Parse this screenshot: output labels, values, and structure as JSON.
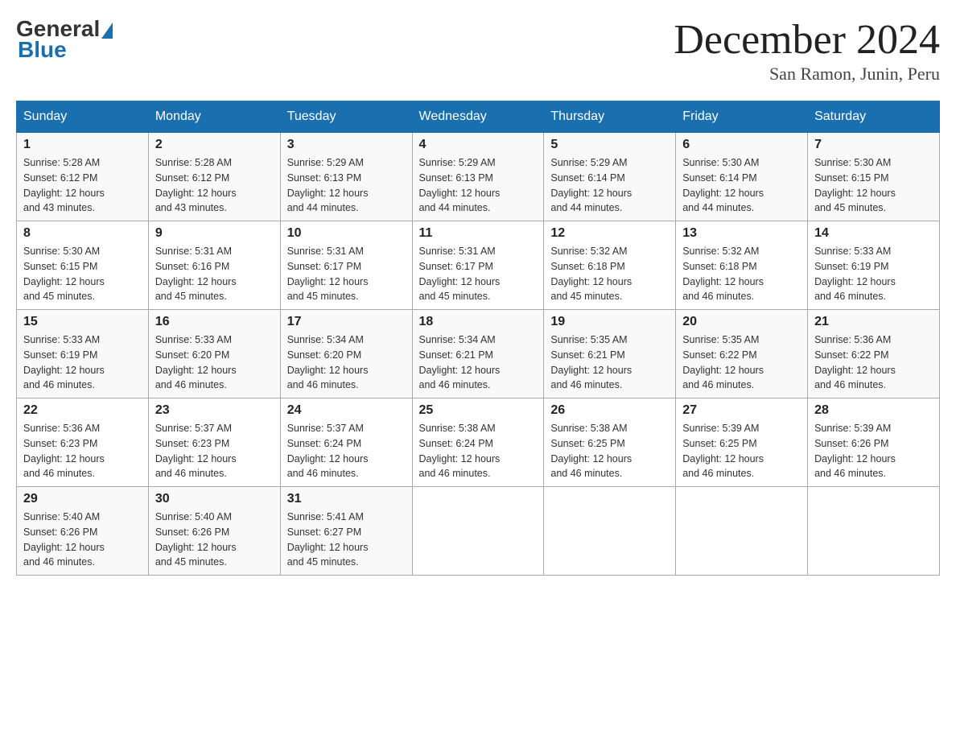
{
  "header": {
    "logo": {
      "general_text": "General",
      "blue_text": "Blue"
    },
    "title": "December 2024",
    "location": "San Ramon, Junin, Peru"
  },
  "days_of_week": [
    "Sunday",
    "Monday",
    "Tuesday",
    "Wednesday",
    "Thursday",
    "Friday",
    "Saturday"
  ],
  "weeks": [
    [
      {
        "day": 1,
        "sunrise": "5:28 AM",
        "sunset": "6:12 PM",
        "daylight": "12 hours and 43 minutes."
      },
      {
        "day": 2,
        "sunrise": "5:28 AM",
        "sunset": "6:12 PM",
        "daylight": "12 hours and 43 minutes."
      },
      {
        "day": 3,
        "sunrise": "5:29 AM",
        "sunset": "6:13 PM",
        "daylight": "12 hours and 44 minutes."
      },
      {
        "day": 4,
        "sunrise": "5:29 AM",
        "sunset": "6:13 PM",
        "daylight": "12 hours and 44 minutes."
      },
      {
        "day": 5,
        "sunrise": "5:29 AM",
        "sunset": "6:14 PM",
        "daylight": "12 hours and 44 minutes."
      },
      {
        "day": 6,
        "sunrise": "5:30 AM",
        "sunset": "6:14 PM",
        "daylight": "12 hours and 44 minutes."
      },
      {
        "day": 7,
        "sunrise": "5:30 AM",
        "sunset": "6:15 PM",
        "daylight": "12 hours and 45 minutes."
      }
    ],
    [
      {
        "day": 8,
        "sunrise": "5:30 AM",
        "sunset": "6:15 PM",
        "daylight": "12 hours and 45 minutes."
      },
      {
        "day": 9,
        "sunrise": "5:31 AM",
        "sunset": "6:16 PM",
        "daylight": "12 hours and 45 minutes."
      },
      {
        "day": 10,
        "sunrise": "5:31 AM",
        "sunset": "6:17 PM",
        "daylight": "12 hours and 45 minutes."
      },
      {
        "day": 11,
        "sunrise": "5:31 AM",
        "sunset": "6:17 PM",
        "daylight": "12 hours and 45 minutes."
      },
      {
        "day": 12,
        "sunrise": "5:32 AM",
        "sunset": "6:18 PM",
        "daylight": "12 hours and 45 minutes."
      },
      {
        "day": 13,
        "sunrise": "5:32 AM",
        "sunset": "6:18 PM",
        "daylight": "12 hours and 46 minutes."
      },
      {
        "day": 14,
        "sunrise": "5:33 AM",
        "sunset": "6:19 PM",
        "daylight": "12 hours and 46 minutes."
      }
    ],
    [
      {
        "day": 15,
        "sunrise": "5:33 AM",
        "sunset": "6:19 PM",
        "daylight": "12 hours and 46 minutes."
      },
      {
        "day": 16,
        "sunrise": "5:33 AM",
        "sunset": "6:20 PM",
        "daylight": "12 hours and 46 minutes."
      },
      {
        "day": 17,
        "sunrise": "5:34 AM",
        "sunset": "6:20 PM",
        "daylight": "12 hours and 46 minutes."
      },
      {
        "day": 18,
        "sunrise": "5:34 AM",
        "sunset": "6:21 PM",
        "daylight": "12 hours and 46 minutes."
      },
      {
        "day": 19,
        "sunrise": "5:35 AM",
        "sunset": "6:21 PM",
        "daylight": "12 hours and 46 minutes."
      },
      {
        "day": 20,
        "sunrise": "5:35 AM",
        "sunset": "6:22 PM",
        "daylight": "12 hours and 46 minutes."
      },
      {
        "day": 21,
        "sunrise": "5:36 AM",
        "sunset": "6:22 PM",
        "daylight": "12 hours and 46 minutes."
      }
    ],
    [
      {
        "day": 22,
        "sunrise": "5:36 AM",
        "sunset": "6:23 PM",
        "daylight": "12 hours and 46 minutes."
      },
      {
        "day": 23,
        "sunrise": "5:37 AM",
        "sunset": "6:23 PM",
        "daylight": "12 hours and 46 minutes."
      },
      {
        "day": 24,
        "sunrise": "5:37 AM",
        "sunset": "6:24 PM",
        "daylight": "12 hours and 46 minutes."
      },
      {
        "day": 25,
        "sunrise": "5:38 AM",
        "sunset": "6:24 PM",
        "daylight": "12 hours and 46 minutes."
      },
      {
        "day": 26,
        "sunrise": "5:38 AM",
        "sunset": "6:25 PM",
        "daylight": "12 hours and 46 minutes."
      },
      {
        "day": 27,
        "sunrise": "5:39 AM",
        "sunset": "6:25 PM",
        "daylight": "12 hours and 46 minutes."
      },
      {
        "day": 28,
        "sunrise": "5:39 AM",
        "sunset": "6:26 PM",
        "daylight": "12 hours and 46 minutes."
      }
    ],
    [
      {
        "day": 29,
        "sunrise": "5:40 AM",
        "sunset": "6:26 PM",
        "daylight": "12 hours and 46 minutes."
      },
      {
        "day": 30,
        "sunrise": "5:40 AM",
        "sunset": "6:26 PM",
        "daylight": "12 hours and 45 minutes."
      },
      {
        "day": 31,
        "sunrise": "5:41 AM",
        "sunset": "6:27 PM",
        "daylight": "12 hours and 45 minutes."
      },
      null,
      null,
      null,
      null
    ]
  ],
  "labels": {
    "sunrise": "Sunrise:",
    "sunset": "Sunset:",
    "daylight": "Daylight:"
  }
}
